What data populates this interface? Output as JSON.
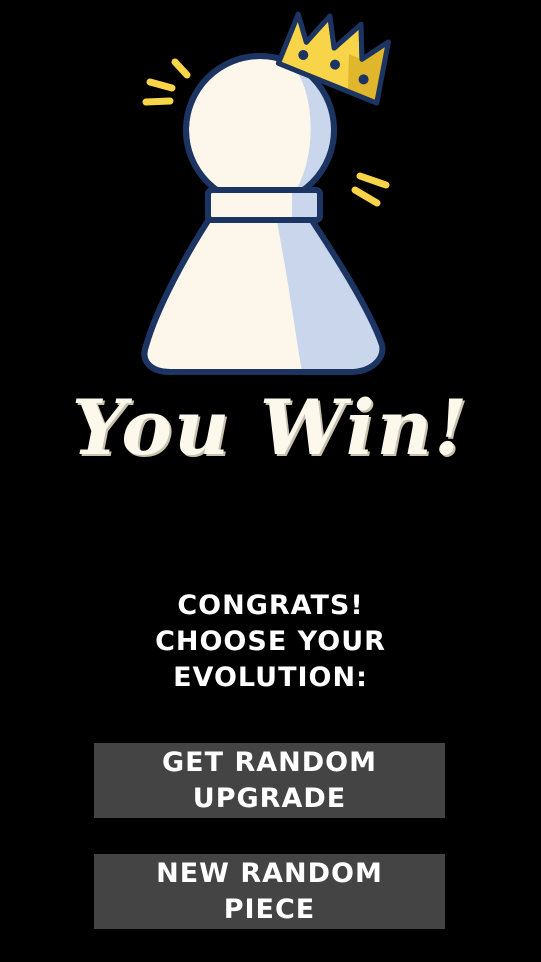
{
  "screen": {
    "background": "#000000",
    "title": "You Win!",
    "message_lines": [
      "CONGRATS!",
      "CHOOSE YOUR",
      "EVOLUTION:"
    ],
    "buttons": {
      "upgrade_lines": [
        "GET RANDOM",
        "UPGRADE"
      ],
      "piece_lines": [
        "NEW RANDOM",
        "PIECE"
      ]
    },
    "art": {
      "icon": "crowned-pawn-icon",
      "pawn_fill": "#fdf6ea",
      "pawn_shade": "#c9d6ec",
      "outline": "#1c3461",
      "crown_fill": "#f8d548",
      "crown_shade": "#e0b72c"
    },
    "button_color": "#444444"
  }
}
